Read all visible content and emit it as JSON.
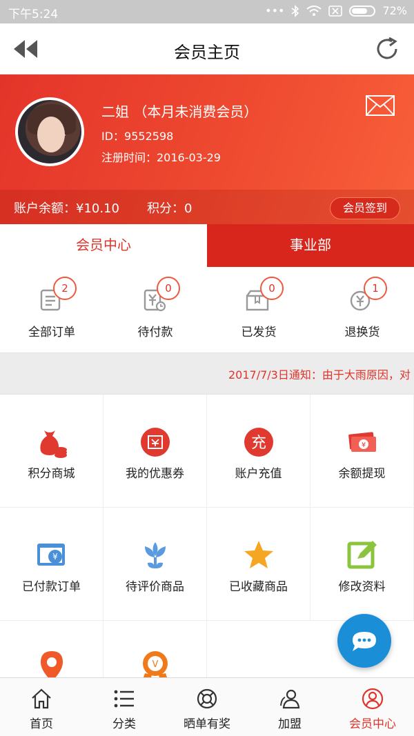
{
  "status_bar": {
    "time": "下午5:24",
    "battery": "72%"
  },
  "header": {
    "title": "会员主页",
    "back_icon": "back-double-arrow-icon",
    "refresh_icon": "refresh-icon"
  },
  "profile": {
    "name": "二姐 （本月未消费会员）",
    "id": "ID：9552598",
    "register": "注册时间：2016-03-29",
    "balance": "账户余额：¥10.10",
    "points": "积分：0",
    "signin_label": "会员签到",
    "mail_icon": "mail-icon"
  },
  "tabs": [
    {
      "label": "会员中心",
      "active": true
    },
    {
      "label": "事业部",
      "active": false
    }
  ],
  "orders": [
    {
      "label": "全部订单",
      "count": "2",
      "icon": "order-list-icon"
    },
    {
      "label": "待付款",
      "count": "0",
      "icon": "pending-payment-icon"
    },
    {
      "label": "已发货",
      "count": "0",
      "icon": "shipped-icon"
    },
    {
      "label": "退换货",
      "count": "1",
      "icon": "return-icon"
    }
  ],
  "notice": "2017/7/3日通知：由于大雨原因，对",
  "grid": [
    {
      "label": "积分商城",
      "icon": "money-bag-icon"
    },
    {
      "label": "我的优惠券",
      "icon": "coupon-icon"
    },
    {
      "label": "账户充值",
      "icon": "recharge-icon"
    },
    {
      "label": "余额提现",
      "icon": "cash-withdraw-icon"
    },
    {
      "label": "已付款订单",
      "icon": "paid-order-icon"
    },
    {
      "label": "待评价商品",
      "icon": "review-flower-icon"
    },
    {
      "label": "已收藏商品",
      "icon": "star-icon"
    },
    {
      "label": "修改资料",
      "icon": "edit-icon"
    },
    {
      "label": "",
      "icon": "location-pin-icon"
    },
    {
      "label": "",
      "icon": "vip-badge-icon"
    }
  ],
  "bottom_nav": [
    {
      "label": "首页",
      "icon": "home-icon",
      "active": false
    },
    {
      "label": "分类",
      "icon": "list-icon",
      "active": false
    },
    {
      "label": "晒单有奖",
      "icon": "lifebuoy-icon",
      "active": false
    },
    {
      "label": "加盟",
      "icon": "users-icon",
      "active": false
    },
    {
      "label": "会员中心",
      "icon": "user-circle-icon",
      "active": true
    }
  ],
  "colors": {
    "primary": "#e0332a",
    "tab_inactive": "#d8261c",
    "chat": "#1a8fd8"
  }
}
